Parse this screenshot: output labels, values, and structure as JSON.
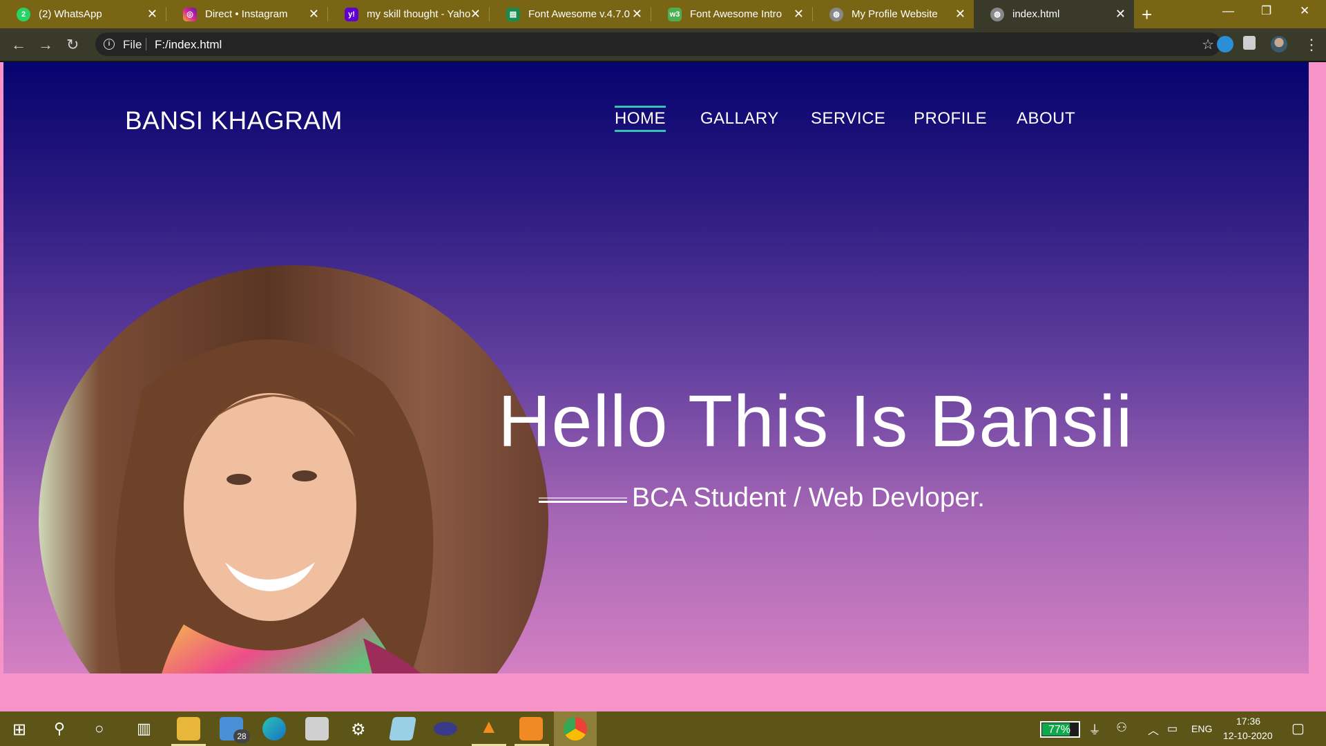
{
  "browser": {
    "tabs": [
      {
        "title": "(2) WhatsApp",
        "icon": "whatsapp-icon",
        "color": "#25d366",
        "glyph": "2"
      },
      {
        "title": "Direct • Instagram",
        "icon": "instagram-icon",
        "color": "#d6249f",
        "glyph": "◎"
      },
      {
        "title": "my skill thought - Yaho",
        "icon": "yahoo-icon",
        "color": "#6001d2",
        "glyph": "y!"
      },
      {
        "title": "Font Awesome v.4.7.0 |",
        "icon": "document-icon",
        "color": "#1a8c4f",
        "glyph": "▤"
      },
      {
        "title": "Font Awesome Intro",
        "icon": "w3schools-icon",
        "color": "#4caf50",
        "glyph": "w3"
      },
      {
        "title": "My Profile Website",
        "icon": "globe-icon",
        "color": "#888888",
        "glyph": "◍"
      },
      {
        "title": "index.html",
        "icon": "globe-icon",
        "color": "#888888",
        "glyph": "◍",
        "active": true
      }
    ],
    "address": {
      "scheme_label": "File",
      "url": "F:/index.html"
    }
  },
  "page": {
    "brand": "BANSI KHAGRAM",
    "nav": [
      {
        "label": "HOME",
        "active": true
      },
      {
        "label": "GALLARY"
      },
      {
        "label": "SERVICE"
      },
      {
        "label": "PROFILE"
      },
      {
        "label": "ABOUT"
      }
    ],
    "heading": "Hello This Is Bansii",
    "subtitle": "BCA Student / Web Devloper.",
    "accent_color": "#31c6b4",
    "gradient": [
      "#05036e",
      "#63409f",
      "#d480c2"
    ]
  },
  "taskbar": {
    "mail_badge": "28",
    "battery": {
      "percent_label": "77%",
      "level": 0.77
    },
    "language": "ENG",
    "time": "17:36",
    "date": "12-10-2020"
  }
}
